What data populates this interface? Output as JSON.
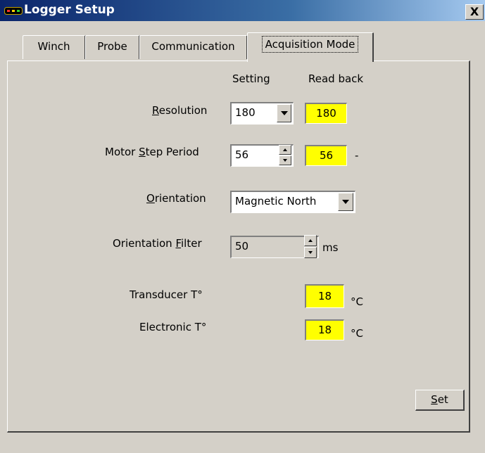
{
  "window": {
    "title": "Logger Setup",
    "close_label": "X"
  },
  "tabs": [
    {
      "label": "Winch",
      "active": false
    },
    {
      "label": "Probe",
      "active": false
    },
    {
      "label": "Communication",
      "active": false
    },
    {
      "label": "Acquisition Mode",
      "active": true
    }
  ],
  "headers": {
    "setting": "Setting",
    "readback": "Read back"
  },
  "resolution": {
    "label_pre": "",
    "label_key": "R",
    "label_post": "esolution",
    "value": "180",
    "readback": "180"
  },
  "motor_step": {
    "label_pre": "Motor ",
    "label_key": "S",
    "label_post": "tep Period",
    "value": "56",
    "readback": "56",
    "unit": "-"
  },
  "orientation": {
    "label_pre": "",
    "label_key": "O",
    "label_post": "rientation",
    "value": "Magnetic North"
  },
  "orientation_filter": {
    "label_pre": "Orientation ",
    "label_key": "F",
    "label_post": "ilter",
    "value": "50",
    "unit": "ms"
  },
  "transducer": {
    "label": "Transducer T°",
    "readback": "18",
    "unit": "°C"
  },
  "electronic": {
    "label": "Electronic T°",
    "readback": "18",
    "unit": "°C"
  },
  "set_button": {
    "key": "S",
    "rest": "et"
  },
  "colors": {
    "readback_bg": "#ffff00",
    "titlebar": "#0a246a",
    "window_bg": "#d4d0c8"
  }
}
